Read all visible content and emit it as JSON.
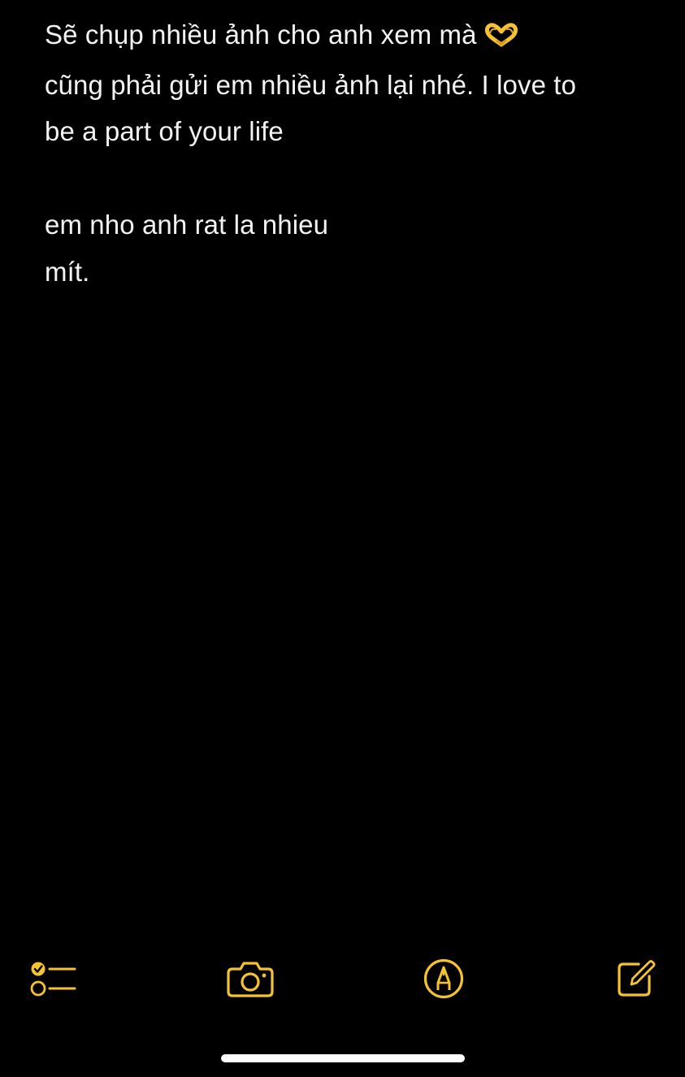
{
  "note": {
    "line1": "Sẽ chụp nhiều ảnh cho anh xem mà",
    "line1_emoji": "heart-hands-emoji",
    "line2": "cũng phải gửi em nhiều ảnh lại nhé. I love to",
    "line3": "be a part of your life",
    "line4": "",
    "line5": "em nho anh rat la nhieu",
    "line6": "mít."
  },
  "toolbar": {
    "checklist_icon": "checklist-icon",
    "camera_icon": "camera-icon",
    "markup_icon": "markup-pen-icon",
    "compose_icon": "compose-icon"
  },
  "colors": {
    "background": "#000000",
    "text": "#f2f2f2",
    "accent": "#f5c332",
    "home_indicator": "#ffffff"
  }
}
